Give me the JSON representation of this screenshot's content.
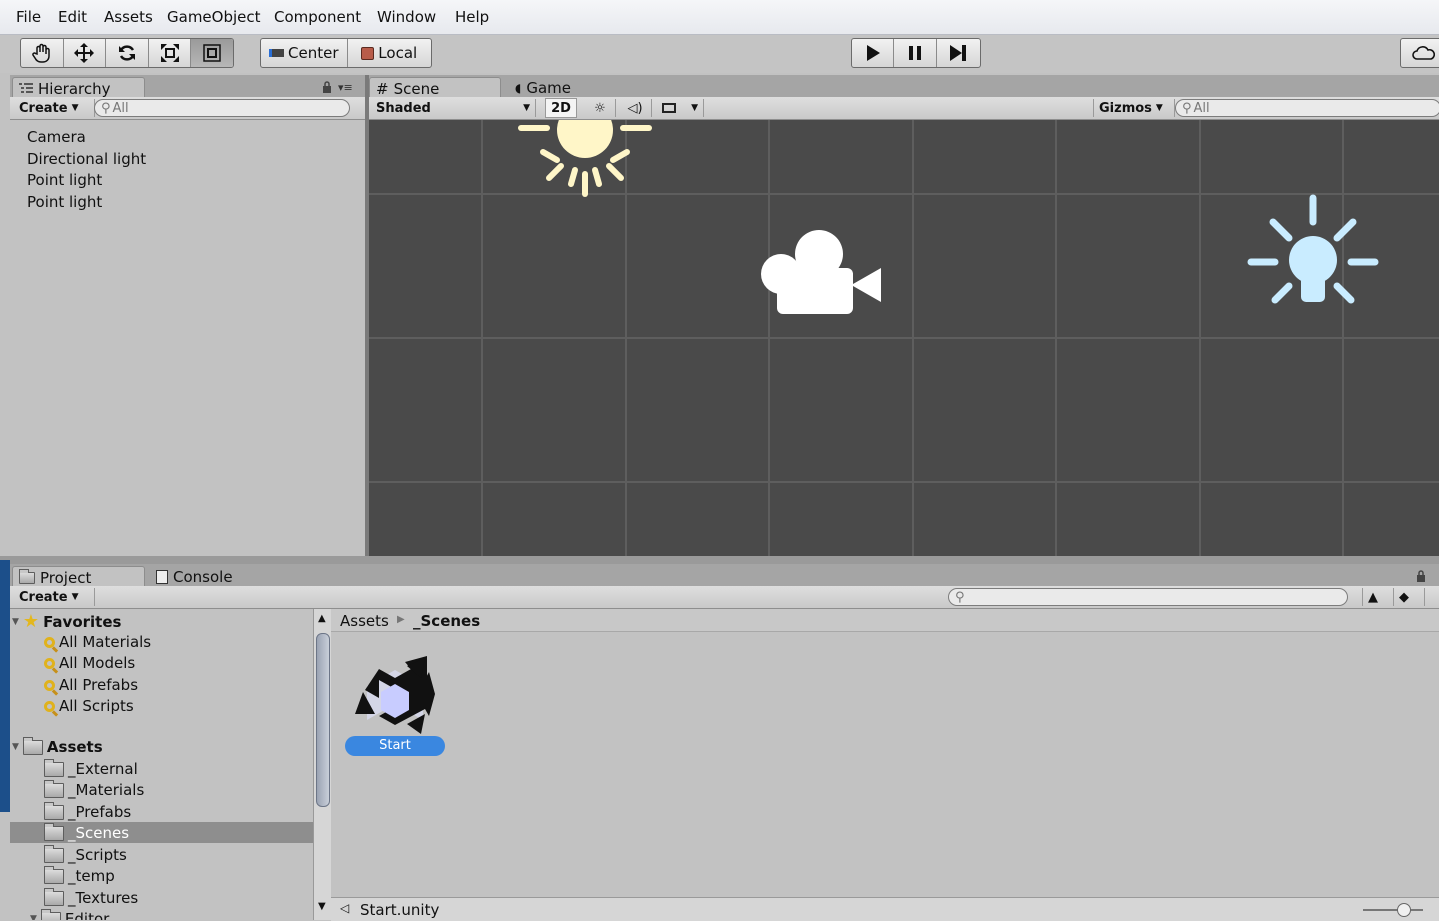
{
  "menu": [
    "File",
    "Edit",
    "Assets",
    "GameObject",
    "Component",
    "Window",
    "Help"
  ],
  "toolbar": {
    "tools": [
      "hand-icon",
      "move-icon",
      "rotate-icon",
      "scale-icon",
      "rect-icon"
    ],
    "pivot_label": "Center",
    "space_label": "Local",
    "play_controls": [
      "play-icon",
      "pause-icon",
      "step-icon"
    ]
  },
  "hierarchy": {
    "tab_label": "Hierarchy",
    "create_label": "Create",
    "search_placeholder": "All",
    "items": [
      "Camera",
      "Directional light",
      "Point light",
      "Point light"
    ]
  },
  "scene": {
    "tab_scene": "Scene",
    "tab_game": "Game",
    "shading": "Shaded",
    "mode_2d": "2D",
    "gizmos_label": "Gizmos",
    "search_placeholder": "All"
  },
  "project": {
    "tab_project": "Project",
    "tab_console": "Console",
    "create_label": "Create",
    "favorites_label": "Favorites",
    "favorites": [
      "All Materials",
      "All Models",
      "All Prefabs",
      "All Scripts"
    ],
    "assets_label": "Assets",
    "folders": [
      "_External",
      "_Materials",
      "_Prefabs",
      "_Scenes",
      "_Scripts",
      "_temp",
      "_Textures",
      "Editor"
    ],
    "selected_folder": "_Scenes",
    "breadcrumb_root": "Assets",
    "breadcrumb_current": "_Scenes",
    "asset_name": "Start",
    "status_file": "Start.unity"
  },
  "colors": {
    "accent": "#3a87e0",
    "scene_bg": "#4a4a4a",
    "selection": "#8e8e8e"
  }
}
